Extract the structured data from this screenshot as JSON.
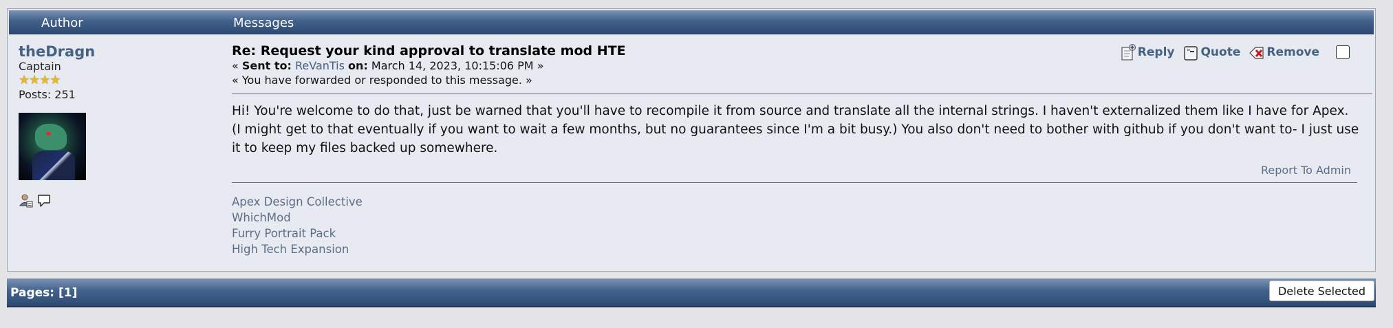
{
  "header": {
    "author_col": "Author",
    "messages_col": "Messages"
  },
  "author": {
    "name": "theDragn",
    "title": "Captain",
    "stars": "★★★★",
    "posts": "Posts: 251"
  },
  "message": {
    "subject": "Re: Request your kind approval to translate mod HTE",
    "sent_prefix": "« ",
    "sent_to_label": "Sent to:",
    "recipient": "ReVanTis",
    "on_label": "on:",
    "date": "March 14, 2023, 10:15:06 PM »",
    "forwarded_note": "« You have forwarded or responded to this message. »",
    "body": "Hi! You're welcome to do that, just be warned that you'll have to recompile it from source and translate all the internal strings. I haven't externalized them like I have for Apex. (I might get to that eventually if you want to wait a few months, but no guarantees since I'm a bit busy.) You also don't need to bother with github if you don't want to- I just use it to keep my files backed up somewhere.",
    "report_link": "Report To Admin"
  },
  "actions": {
    "reply": "Reply",
    "quote": "Quote",
    "remove": "Remove"
  },
  "signature": {
    "links": [
      "Apex Design Collective",
      "WhichMod",
      "Furry Portrait Pack",
      "High Tech Expansion"
    ]
  },
  "footer": {
    "pages_label": "Pages:",
    "current_page": "[1]",
    "delete_button": "Delete Selected"
  },
  "colors": {
    "header_gradient_top": "#7b93b3",
    "header_gradient_bottom": "#2e4a73",
    "link": "#456283",
    "muted_link": "#5d6e86",
    "panel_bg": "#e8eaf1"
  },
  "icons": {
    "reply": "reply-icon",
    "quote": "quote-icon",
    "remove": "remove-icon",
    "profile": "profile-icon",
    "pm": "personal-message-icon"
  }
}
